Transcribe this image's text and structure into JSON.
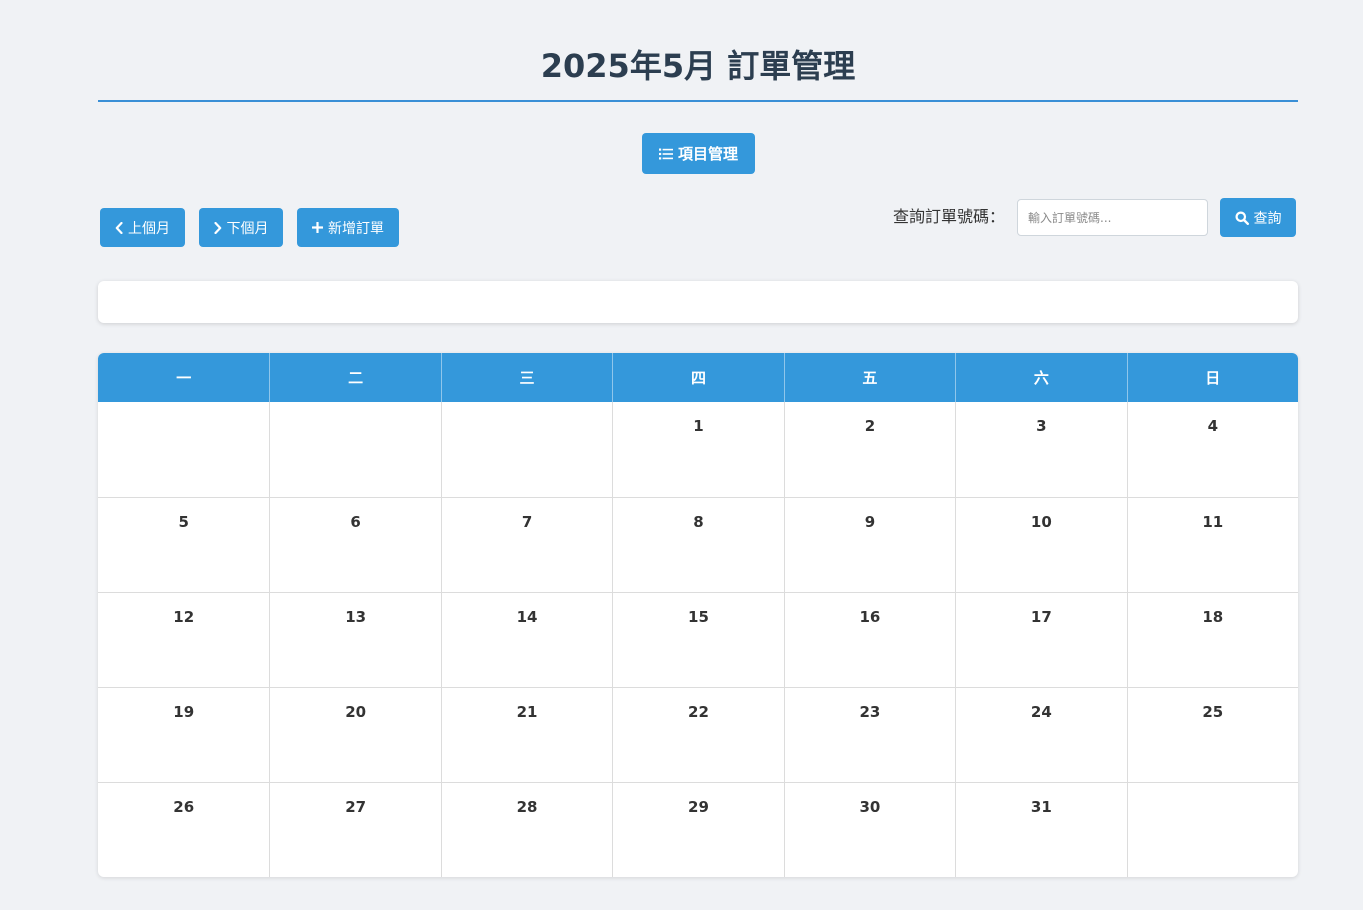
{
  "header": {
    "title": "2025年5月 訂單管理"
  },
  "toolbar": {
    "items_button_label": "項目管理",
    "prev_month_label": "上個月",
    "next_month_label": "下個月",
    "new_order_label": "新增訂單"
  },
  "search": {
    "label": "查詢訂單號碼：",
    "placeholder": "輸入訂單號碼...",
    "value": "",
    "button_label": "查詢"
  },
  "icons": {
    "items_button": "list-icon",
    "prev_month": "chevron-left-icon",
    "next_month": "chevron-right-icon",
    "new_order": "plus-icon",
    "search": "search-icon"
  },
  "colors": {
    "accent": "#3498db",
    "page_background": "#f0f2f5",
    "title_text": "#2c3e50"
  },
  "calendar": {
    "weekdays": [
      "一",
      "二",
      "三",
      "四",
      "五",
      "六",
      "日"
    ],
    "weeks": [
      [
        "",
        "",
        "",
        "1",
        "2",
        "3",
        "4"
      ],
      [
        "5",
        "6",
        "7",
        "8",
        "9",
        "10",
        "11"
      ],
      [
        "12",
        "13",
        "14",
        "15",
        "16",
        "17",
        "18"
      ],
      [
        "19",
        "20",
        "21",
        "22",
        "23",
        "24",
        "25"
      ],
      [
        "26",
        "27",
        "28",
        "29",
        "30",
        "31",
        ""
      ]
    ]
  }
}
